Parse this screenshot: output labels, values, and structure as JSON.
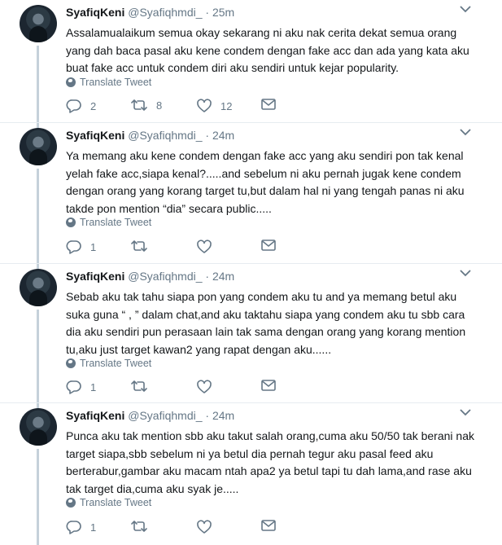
{
  "tweets": [
    {
      "name": "SyafiqKeni",
      "handle": "@Syafiqhmdi_",
      "dot": "·",
      "time": "25m",
      "lines": [
        "Assalamualaikum semua okay sekarang ni aku nak cerita dekat semua orang",
        "yang dah baca pasal aku kene condem dengan fake acc dan ada yang kata aku",
        "buat fake acc untuk condem diri aku sendiri untuk kejar popularity."
      ],
      "translate": "Translate Tweet",
      "replies": "2",
      "retweets": "8",
      "likes": "12"
    },
    {
      "name": "SyafiqKeni",
      "handle": "@Syafiqhmdi_",
      "dot": "·",
      "time": "24m",
      "lines": [
        "Ya memang aku kene condem dengan fake acc yang aku sendiri pon tak kenal",
        "yelah fake acc,siapa kenal?.....and sebelum ni aku pernah jugak kene condem",
        "dengan orang yang korang target tu,but dalam hal ni yang tengah panas ni aku",
        "takde pon mention “dia” secara public....."
      ],
      "translate": "Translate Tweet",
      "replies": "1",
      "retweets": "",
      "likes": ""
    },
    {
      "name": "SyafiqKeni",
      "handle": "@Syafiqhmdi_",
      "dot": "·",
      "time": "24m",
      "lines": [
        "Sebab aku tak tahu siapa pon yang condem aku tu and ya memang betul aku",
        "suka guna “ , ” dalam chat,and aku taktahu siapa yang condem aku tu sbb cara",
        "dia aku sendiri pun perasaan lain tak sama dengan orang yang korang mention",
        "tu,aku just target kawan2 yang rapat dengan aku......"
      ],
      "translate": "Translate Tweet",
      "replies": "1",
      "retweets": "",
      "likes": ""
    },
    {
      "name": "SyafiqKeni",
      "handle": "@Syafiqhmdi_",
      "dot": "·",
      "time": "24m",
      "lines": [
        "Punca aku tak mention sbb aku takut salah orang,cuma aku 50/50 tak berani nak",
        "target siapa,sbb sebelum ni ya betul dia pernah tegur aku pasal feed aku",
        "berterabur,gambar aku macam ntah apa2 ya betul tapi tu dah lama,and rase aku",
        "tak target dia,cuma aku syak je....."
      ],
      "translate": "Translate Tweet",
      "replies": "1",
      "retweets": "",
      "likes": ""
    }
  ],
  "icons": {
    "reply": "reply-icon",
    "retweet": "retweet-icon",
    "like": "heart-icon",
    "message": "envelope-icon",
    "translate": "globe-icon",
    "caret": "chevron-down-icon"
  },
  "colors": {
    "text": "#14171a",
    "muted": "#657786",
    "divider": "#e6ecf0",
    "thread_line": "#c5d1da"
  }
}
